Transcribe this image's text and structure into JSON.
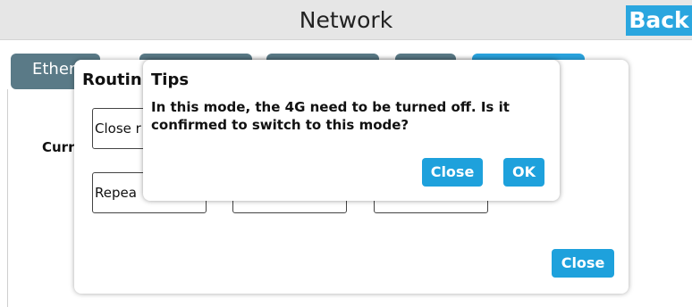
{
  "header": {
    "title": "Network",
    "back_label": "Back"
  },
  "tabs": [
    {
      "label": "Ether",
      "active": false
    },
    {
      "label": "",
      "active": false
    },
    {
      "label": "",
      "active": false
    },
    {
      "label": "",
      "active": false
    },
    {
      "label": "",
      "active": true
    }
  ],
  "main": {
    "current_label": "Curr"
  },
  "routing_dialog": {
    "title": "Routin",
    "mode_buttons": [
      "Close r",
      "Repea",
      "",
      ""
    ],
    "close_label": "Close"
  },
  "tips_dialog": {
    "title": "Tips",
    "message": "In this mode, the 4G need to be turned off. Is it confirmed to switch to this mode?",
    "close_label": "Close",
    "ok_label": "OK"
  },
  "colors": {
    "accent": "#1ea1dc",
    "tab_inactive": "#5a7a87",
    "header_bg": "#e6e6e6"
  }
}
